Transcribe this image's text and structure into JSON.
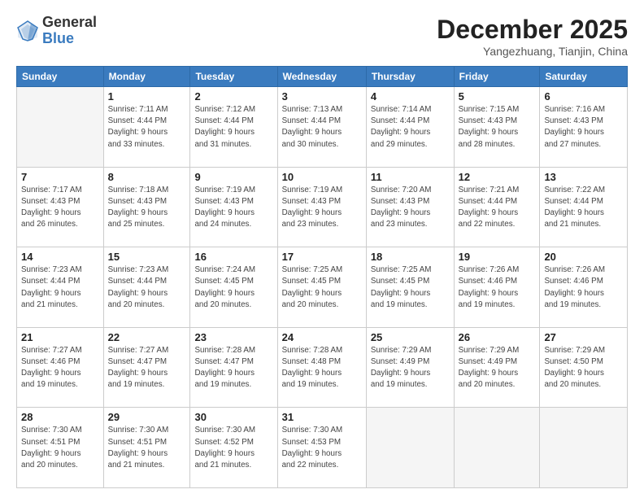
{
  "header": {
    "logo_line1": "General",
    "logo_line2": "Blue",
    "month": "December 2025",
    "location": "Yangezhuang, Tianjin, China"
  },
  "days_of_week": [
    "Sunday",
    "Monday",
    "Tuesday",
    "Wednesday",
    "Thursday",
    "Friday",
    "Saturday"
  ],
  "weeks": [
    [
      {
        "day": "",
        "info": ""
      },
      {
        "day": "1",
        "info": "Sunrise: 7:11 AM\nSunset: 4:44 PM\nDaylight: 9 hours\nand 33 minutes."
      },
      {
        "day": "2",
        "info": "Sunrise: 7:12 AM\nSunset: 4:44 PM\nDaylight: 9 hours\nand 31 minutes."
      },
      {
        "day": "3",
        "info": "Sunrise: 7:13 AM\nSunset: 4:44 PM\nDaylight: 9 hours\nand 30 minutes."
      },
      {
        "day": "4",
        "info": "Sunrise: 7:14 AM\nSunset: 4:44 PM\nDaylight: 9 hours\nand 29 minutes."
      },
      {
        "day": "5",
        "info": "Sunrise: 7:15 AM\nSunset: 4:43 PM\nDaylight: 9 hours\nand 28 minutes."
      },
      {
        "day": "6",
        "info": "Sunrise: 7:16 AM\nSunset: 4:43 PM\nDaylight: 9 hours\nand 27 minutes."
      }
    ],
    [
      {
        "day": "7",
        "info": "Sunrise: 7:17 AM\nSunset: 4:43 PM\nDaylight: 9 hours\nand 26 minutes."
      },
      {
        "day": "8",
        "info": "Sunrise: 7:18 AM\nSunset: 4:43 PM\nDaylight: 9 hours\nand 25 minutes."
      },
      {
        "day": "9",
        "info": "Sunrise: 7:19 AM\nSunset: 4:43 PM\nDaylight: 9 hours\nand 24 minutes."
      },
      {
        "day": "10",
        "info": "Sunrise: 7:19 AM\nSunset: 4:43 PM\nDaylight: 9 hours\nand 23 minutes."
      },
      {
        "day": "11",
        "info": "Sunrise: 7:20 AM\nSunset: 4:43 PM\nDaylight: 9 hours\nand 23 minutes."
      },
      {
        "day": "12",
        "info": "Sunrise: 7:21 AM\nSunset: 4:44 PM\nDaylight: 9 hours\nand 22 minutes."
      },
      {
        "day": "13",
        "info": "Sunrise: 7:22 AM\nSunset: 4:44 PM\nDaylight: 9 hours\nand 21 minutes."
      }
    ],
    [
      {
        "day": "14",
        "info": "Sunrise: 7:23 AM\nSunset: 4:44 PM\nDaylight: 9 hours\nand 21 minutes."
      },
      {
        "day": "15",
        "info": "Sunrise: 7:23 AM\nSunset: 4:44 PM\nDaylight: 9 hours\nand 20 minutes."
      },
      {
        "day": "16",
        "info": "Sunrise: 7:24 AM\nSunset: 4:45 PM\nDaylight: 9 hours\nand 20 minutes."
      },
      {
        "day": "17",
        "info": "Sunrise: 7:25 AM\nSunset: 4:45 PM\nDaylight: 9 hours\nand 20 minutes."
      },
      {
        "day": "18",
        "info": "Sunrise: 7:25 AM\nSunset: 4:45 PM\nDaylight: 9 hours\nand 19 minutes."
      },
      {
        "day": "19",
        "info": "Sunrise: 7:26 AM\nSunset: 4:46 PM\nDaylight: 9 hours\nand 19 minutes."
      },
      {
        "day": "20",
        "info": "Sunrise: 7:26 AM\nSunset: 4:46 PM\nDaylight: 9 hours\nand 19 minutes."
      }
    ],
    [
      {
        "day": "21",
        "info": "Sunrise: 7:27 AM\nSunset: 4:46 PM\nDaylight: 9 hours\nand 19 minutes."
      },
      {
        "day": "22",
        "info": "Sunrise: 7:27 AM\nSunset: 4:47 PM\nDaylight: 9 hours\nand 19 minutes."
      },
      {
        "day": "23",
        "info": "Sunrise: 7:28 AM\nSunset: 4:47 PM\nDaylight: 9 hours\nand 19 minutes."
      },
      {
        "day": "24",
        "info": "Sunrise: 7:28 AM\nSunset: 4:48 PM\nDaylight: 9 hours\nand 19 minutes."
      },
      {
        "day": "25",
        "info": "Sunrise: 7:29 AM\nSunset: 4:49 PM\nDaylight: 9 hours\nand 19 minutes."
      },
      {
        "day": "26",
        "info": "Sunrise: 7:29 AM\nSunset: 4:49 PM\nDaylight: 9 hours\nand 20 minutes."
      },
      {
        "day": "27",
        "info": "Sunrise: 7:29 AM\nSunset: 4:50 PM\nDaylight: 9 hours\nand 20 minutes."
      }
    ],
    [
      {
        "day": "28",
        "info": "Sunrise: 7:30 AM\nSunset: 4:51 PM\nDaylight: 9 hours\nand 20 minutes."
      },
      {
        "day": "29",
        "info": "Sunrise: 7:30 AM\nSunset: 4:51 PM\nDaylight: 9 hours\nand 21 minutes."
      },
      {
        "day": "30",
        "info": "Sunrise: 7:30 AM\nSunset: 4:52 PM\nDaylight: 9 hours\nand 21 minutes."
      },
      {
        "day": "31",
        "info": "Sunrise: 7:30 AM\nSunset: 4:53 PM\nDaylight: 9 hours\nand 22 minutes."
      },
      {
        "day": "",
        "info": ""
      },
      {
        "day": "",
        "info": ""
      },
      {
        "day": "",
        "info": ""
      }
    ]
  ]
}
